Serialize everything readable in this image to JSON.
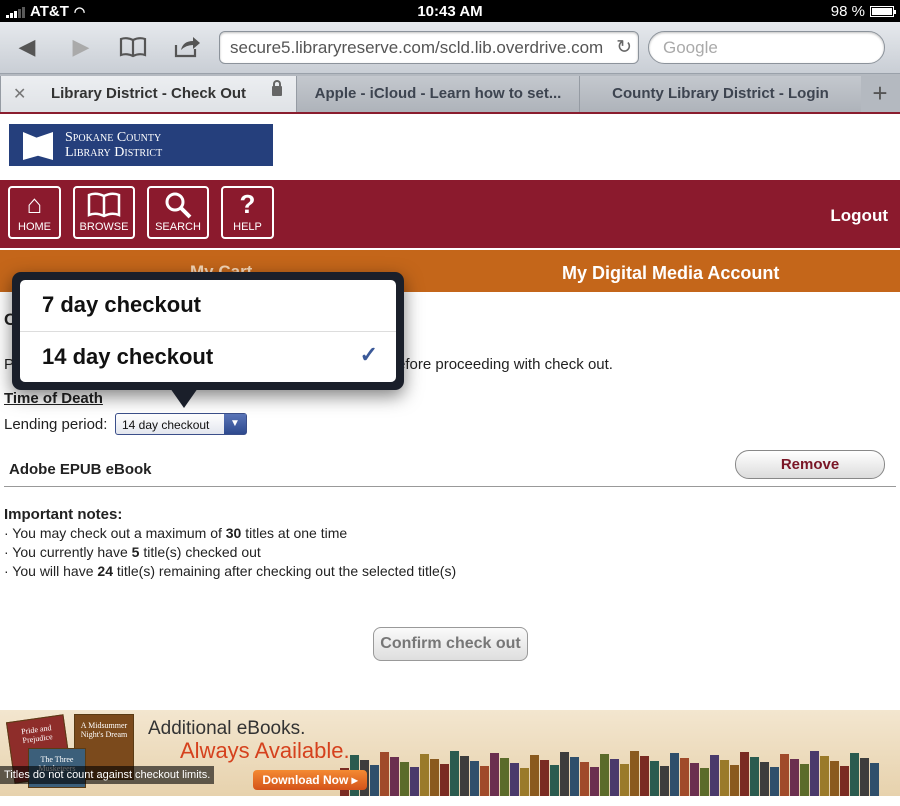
{
  "status": {
    "carrier": "AT&T",
    "time": "10:43 AM",
    "battery": "98 %"
  },
  "browser": {
    "url": "secure5.libraryreserve.com/scld.lib.overdrive.com",
    "search_placeholder": "Google",
    "tabs": [
      {
        "label": "Library District - Check Out"
      },
      {
        "label": "Apple - iCloud - Learn how to set..."
      },
      {
        "label": "County Library District - Login"
      }
    ]
  },
  "site": {
    "logo_line1": "Spokane County",
    "logo_line2": "Library District",
    "nav": [
      {
        "label": "HOME",
        "icon": "home-icon"
      },
      {
        "label": "BROWSE",
        "icon": "book-icon"
      },
      {
        "label": "SEARCH",
        "icon": "search-icon"
      },
      {
        "label": "HELP",
        "icon": "question-icon"
      }
    ],
    "logout": "Logout",
    "tab_cart": "My Cart",
    "tab_account": "My Digital Media Account"
  },
  "checkout": {
    "heading_partial": "C",
    "instruction_partial": "P",
    "instruction_rest": "efore proceeding with check out.",
    "title": "Time of Death",
    "lending_label": "Lending period:",
    "lending_value": "14 day checkout",
    "format": "Adobe EPUB eBook",
    "remove": "Remove",
    "notes_heading": "Important notes:",
    "notes": [
      {
        "pre": "· You may check out a maximum of ",
        "num": "30",
        "post": " titles at one time"
      },
      {
        "pre": "· You currently have ",
        "num": "5",
        "post": " title(s) checked out"
      },
      {
        "pre": "· You will have ",
        "num": "24",
        "post": " title(s) remaining after checking out the selected title(s)"
      }
    ],
    "confirm": "Confirm check out"
  },
  "popover": {
    "options": [
      {
        "label": "7 day checkout",
        "selected": false
      },
      {
        "label": "14 day checkout",
        "selected": true
      }
    ],
    "check": "✓"
  },
  "banner": {
    "line1": "Additional eBooks.",
    "line2": "Always Available.",
    "button": "Download Now ▸",
    "note": "Titles do not count against checkout limits.",
    "book1": "Pride and Prejudice",
    "book2": "A Midsummer Night's Dream",
    "book3": "The Three Musketeers"
  },
  "colors": {
    "brand_red": "#8b1a2d",
    "brand_orange": "#c4661a",
    "logo_blue": "#253f7c"
  }
}
